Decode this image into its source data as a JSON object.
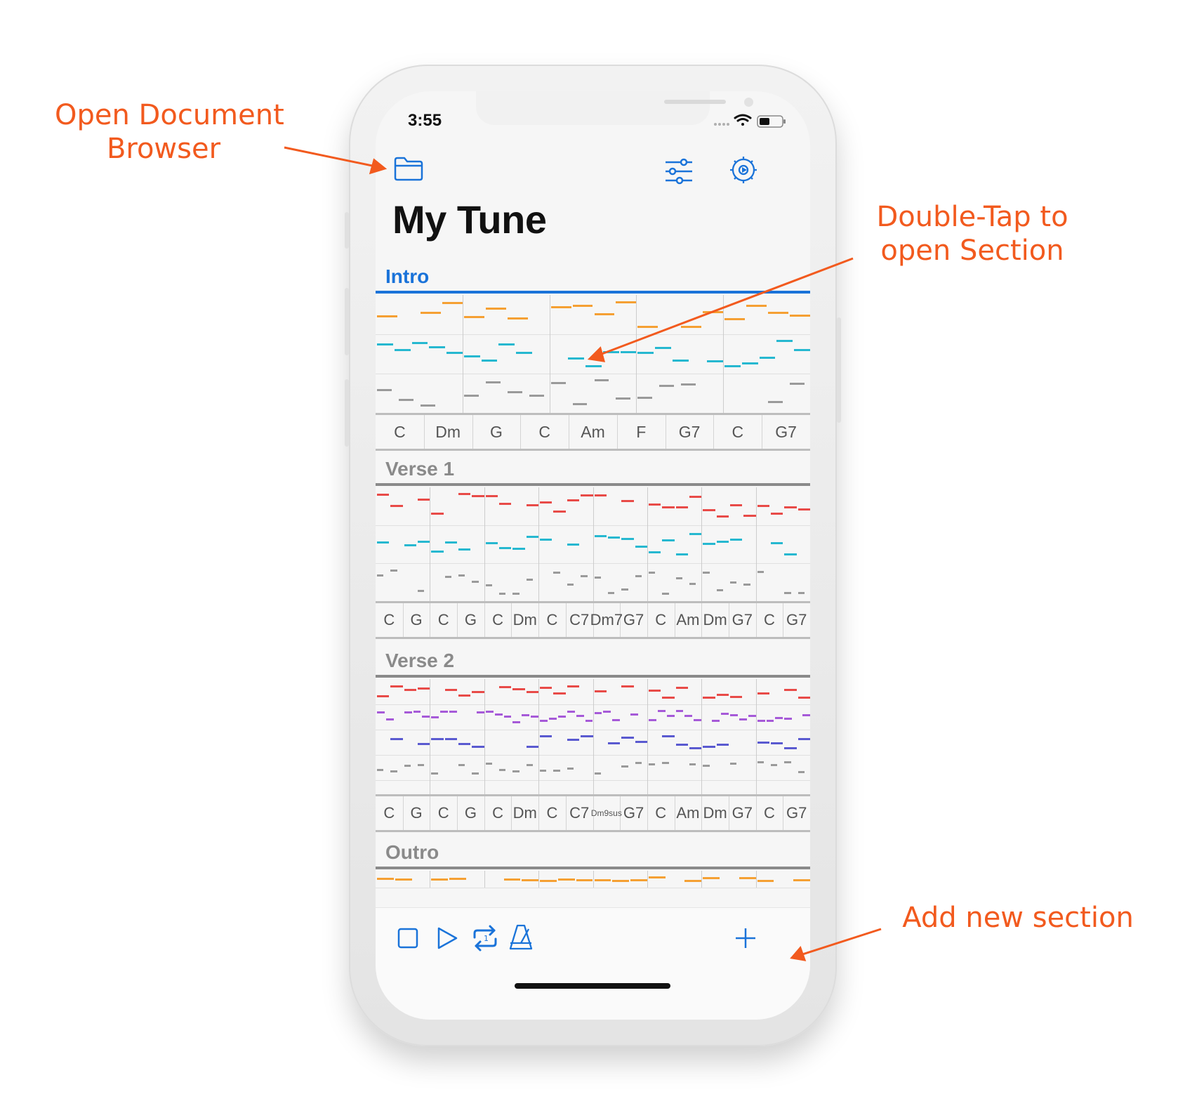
{
  "callouts": {
    "open_browser": "Open Document\nBrowser",
    "double_tap": "Double-Tap to\nopen Section",
    "add_section": "Add new section"
  },
  "status": {
    "time": "3:55"
  },
  "document": {
    "title": "My Tune"
  },
  "sections": [
    {
      "id": "intro",
      "label": "Intro",
      "selected": true,
      "chords": [
        "C",
        "Dm",
        "G",
        "C",
        "Am",
        "F",
        "G7",
        "C",
        "G7"
      ]
    },
    {
      "id": "verse1",
      "label": "Verse 1",
      "selected": false,
      "chords": [
        "C",
        "G",
        "C",
        "G",
        "C",
        "Dm",
        "C",
        "C7",
        "Dm7",
        "G7",
        "C",
        "Am",
        "Dm",
        "G7",
        "C",
        "G7"
      ]
    },
    {
      "id": "verse2",
      "label": "Verse 2",
      "selected": false,
      "chords": [
        "C",
        "G",
        "C",
        "G",
        "C",
        "Dm",
        "C",
        "C7",
        "Dm9sus",
        "G7",
        "C",
        "Am",
        "Dm",
        "G7",
        "C",
        "G7"
      ]
    },
    {
      "id": "outro",
      "label": "Outro",
      "selected": false,
      "chords": []
    }
  ],
  "icons": {
    "nav_left": "folder-icon",
    "nav_right": [
      "sliders-icon",
      "gear-icon"
    ],
    "toolbar": [
      "stop-icon",
      "play-icon",
      "loop-icon",
      "metronome-icon",
      "plus-icon"
    ]
  },
  "colors": {
    "accent": "#1a73d9",
    "callout": "#f25a1e",
    "section_inactive": "#8a8a8a",
    "track_melody": "#f5a033",
    "track_lead": "#e84b48",
    "track_bass": "#26b8d0",
    "track_pad": "#a65ad8",
    "track_chords": "#5a5ad0",
    "track_drums": "#9a9a9a",
    "track_kick": "#b4865a"
  }
}
